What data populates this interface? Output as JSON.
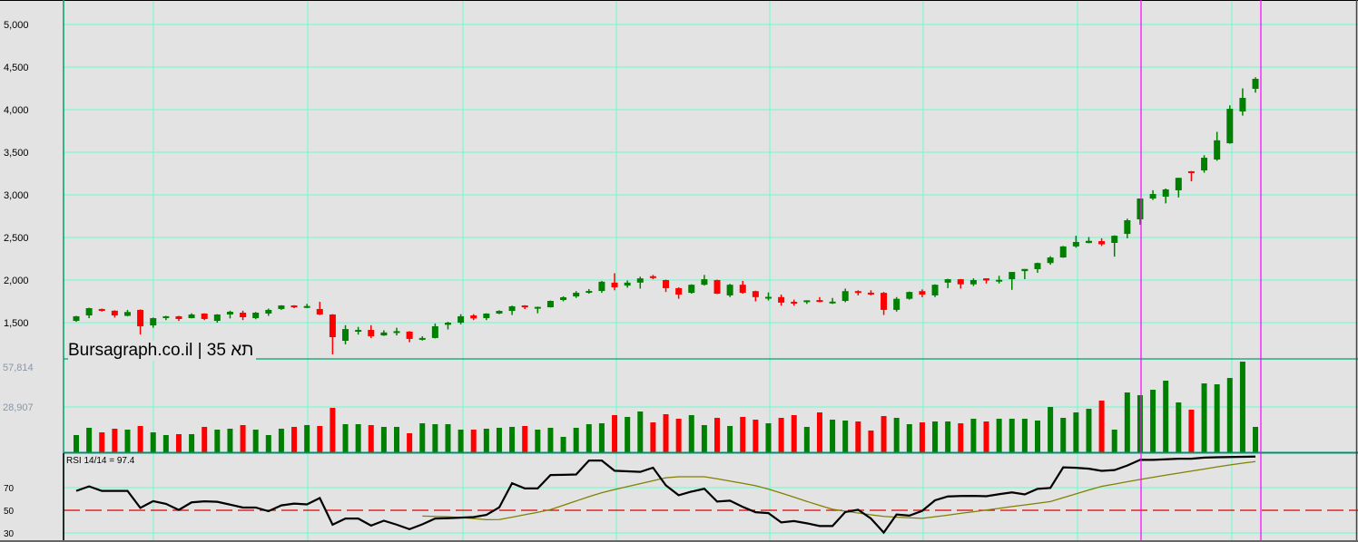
{
  "title": "Bursagraph.co.il | תא 35",
  "rsi_label": "RSI 14/14 = 97.4",
  "colors": {
    "up": "#008000",
    "down": "#ff0000",
    "grid": "#66ffcc",
    "axis": "#00a070",
    "marker": "#ff00ff",
    "rsi": "#000000",
    "signal": "#808000",
    "midline": "#e00000"
  },
  "chart_data": [
    {
      "type": "candlestick",
      "title": "Bursagraph.co.il | תא 35",
      "ylim": [
        1500,
        5000
      ],
      "y_ticks": [
        5000,
        4500,
        4000,
        3500,
        3000,
        2500,
        2000,
        1500
      ],
      "y_tick_labels": [
        "5,000",
        "4,500",
        "4,000",
        "3,500",
        "3,000",
        "2,500",
        "2,000",
        "1,500"
      ],
      "grid": true,
      "ohlc_order": [
        "open",
        "high",
        "low",
        "close"
      ],
      "ohlc": [
        [
          1521,
          1580,
          1510,
          1575
        ],
        [
          1585,
          1675,
          1553,
          1670
        ],
        [
          1660,
          1665,
          1630,
          1650
        ],
        [
          1640,
          1645,
          1560,
          1585
        ],
        [
          1580,
          1650,
          1575,
          1625
        ],
        [
          1650,
          1655,
          1362,
          1458
        ],
        [
          1468,
          1560,
          1440,
          1553
        ],
        [
          1565,
          1580,
          1530,
          1575
        ],
        [
          1575,
          1580,
          1520,
          1543
        ],
        [
          1553,
          1610,
          1550,
          1596
        ],
        [
          1607,
          1610,
          1530,
          1543
        ],
        [
          1521,
          1600,
          1500,
          1596
        ],
        [
          1596,
          1640,
          1550,
          1628
        ],
        [
          1617,
          1640,
          1530,
          1564
        ],
        [
          1553,
          1625,
          1540,
          1617
        ],
        [
          1607,
          1665,
          1580,
          1650
        ],
        [
          1660,
          1705,
          1650,
          1702
        ],
        [
          1702,
          1705,
          1670,
          1681
        ],
        [
          1692,
          1720,
          1670,
          1695
        ],
        [
          1660,
          1745,
          1590,
          1596
        ],
        [
          1596,
          1600,
          1128,
          1330
        ],
        [
          1287,
          1470,
          1245,
          1425
        ],
        [
          1405,
          1450,
          1360,
          1415
        ],
        [
          1415,
          1470,
          1320,
          1340
        ],
        [
          1350,
          1410,
          1345,
          1385
        ],
        [
          1395,
          1440,
          1350,
          1400
        ],
        [
          1395,
          1400,
          1270,
          1309
        ],
        [
          1310,
          1340,
          1290,
          1320
        ],
        [
          1320,
          1490,
          1315,
          1458
        ],
        [
          1475,
          1510,
          1420,
          1500
        ],
        [
          1500,
          1600,
          1480,
          1575
        ],
        [
          1585,
          1600,
          1530,
          1550
        ],
        [
          1553,
          1610,
          1530,
          1607
        ],
        [
          1607,
          1645,
          1600,
          1638
        ],
        [
          1638,
          1700,
          1590,
          1692
        ],
        [
          1702,
          1705,
          1660,
          1681
        ],
        [
          1680,
          1688,
          1610,
          1685
        ],
        [
          1681,
          1760,
          1678,
          1755
        ],
        [
          1766,
          1810,
          1750,
          1798
        ],
        [
          1808,
          1870,
          1790,
          1851
        ],
        [
          1868,
          1895,
          1840,
          1872
        ],
        [
          1872,
          1990,
          1850,
          1980
        ],
        [
          1970,
          2080,
          1880,
          1915
        ],
        [
          1935,
          1995,
          1910,
          1970
        ],
        [
          1970,
          2040,
          1900,
          2020
        ],
        [
          2045,
          2060,
          2010,
          2040
        ],
        [
          2000,
          2005,
          1860,
          1905
        ],
        [
          1905,
          1915,
          1780,
          1830
        ],
        [
          1850,
          1950,
          1840,
          1945
        ],
        [
          1945,
          2060,
          1935,
          2010
        ],
        [
          2000,
          2005,
          1835,
          1840
        ],
        [
          1820,
          1955,
          1800,
          1945
        ],
        [
          1945,
          1990,
          1840,
          1850
        ],
        [
          1870,
          1875,
          1750,
          1800
        ],
        [
          1800,
          1855,
          1760,
          1803
        ],
        [
          1800,
          1830,
          1700,
          1735
        ],
        [
          1745,
          1770,
          1700,
          1740
        ],
        [
          1758,
          1762,
          1720,
          1762
        ],
        [
          1765,
          1800,
          1740,
          1745
        ],
        [
          1743,
          1790,
          1720,
          1747
        ],
        [
          1755,
          1900,
          1740,
          1870
        ],
        [
          1870,
          1880,
          1820,
          1850
        ],
        [
          1852,
          1880,
          1820,
          1848
        ],
        [
          1850,
          1860,
          1590,
          1650
        ],
        [
          1650,
          1800,
          1630,
          1780
        ],
        [
          1780,
          1865,
          1770,
          1860
        ],
        [
          1870,
          1890,
          1800,
          1830
        ],
        [
          1820,
          1950,
          1800,
          1945
        ],
        [
          1970,
          2015,
          1905,
          2010
        ],
        [
          2010,
          2012,
          1900,
          1950
        ],
        [
          1950,
          2020,
          1930,
          2000
        ],
        [
          2020,
          2022,
          1960,
          1995
        ],
        [
          1998,
          2050,
          1960,
          2003
        ],
        [
          2010,
          2095,
          1885,
          2095
        ],
        [
          2105,
          2130,
          2010,
          2130
        ],
        [
          2128,
          2205,
          2085,
          2200
        ],
        [
          2200,
          2280,
          2180,
          2265
        ],
        [
          2265,
          2400,
          2262,
          2395
        ],
        [
          2395,
          2520,
          2380,
          2447
        ],
        [
          2435,
          2505,
          2432,
          2460
        ],
        [
          2457,
          2490,
          2400,
          2420
        ],
        [
          2436,
          2525,
          2275,
          2520
        ],
        [
          2542,
          2720,
          2490,
          2702
        ],
        [
          2713,
          2957,
          2650,
          2957
        ],
        [
          2957,
          3055,
          2940,
          3010
        ],
        [
          2979,
          3075,
          2900,
          3064
        ],
        [
          3053,
          3200,
          2970,
          3200
        ],
        [
          3277,
          3280,
          3160,
          3270
        ],
        [
          3287,
          3465,
          3260,
          3436
        ],
        [
          3415,
          3740,
          3400,
          3640
        ],
        [
          3606,
          4050,
          3600,
          4010
        ],
        [
          3979,
          4250,
          3930,
          4138
        ],
        [
          4245,
          4380,
          4200,
          4362
        ]
      ],
      "marker_indices": [
        83,
        93
      ]
    },
    {
      "type": "bar",
      "name": "volume",
      "ylim": [
        0,
        57814
      ],
      "y_ticks": [
        57814,
        28907
      ],
      "y_tick_labels": [
        "57,814",
        "28,907"
      ],
      "values": [
        10982,
        15606,
        12716,
        15028,
        14450,
        16762,
        12716,
        10982,
        11560,
        11560,
        16184,
        14450,
        15028,
        17340,
        14450,
        10982,
        15028,
        16184,
        17340,
        16762,
        28322,
        17918,
        17918,
        17340,
        16184,
        16184,
        12138,
        18496,
        17918,
        17918,
        14450,
        14450,
        15028,
        15606,
        16184,
        16762,
        14450,
        15606,
        9826,
        15606,
        17918,
        18496,
        23698,
        22542,
        26010,
        19074,
        24276,
        21386,
        23698,
        17340,
        21964,
        16762,
        22542,
        20808,
        18496,
        21964,
        23698,
        16184,
        25432,
        20808,
        20230,
        19652,
        13872,
        23120,
        21964,
        17918,
        19074,
        19652,
        19652,
        18496,
        21386,
        19652,
        21386,
        21386,
        21386,
        20230,
        28900,
        21964,
        25432,
        27744,
        32946,
        14450,
        38148,
        36414,
        39882,
        45662,
        31790,
        27166,
        43928,
        43350,
        47396,
        57800,
        16184
      ]
    },
    {
      "type": "line",
      "name": "RSI 14/14",
      "ylim": [
        25,
        100
      ],
      "y_ticks": [
        70,
        50,
        30
      ],
      "y_tick_labels": [
        "70",
        "50",
        "30"
      ],
      "series": [
        {
          "name": "RSI",
          "values": [
            67.1,
            71.1,
            67.1,
            67.1,
            67.1,
            52.1,
            58.1,
            55.7,
            50.3,
            57,
            57.9,
            57.5,
            55,
            52.4,
            52.4,
            49.2,
            54.3,
            55.9,
            55.2,
            60.8,
            37.3,
            42.7,
            42.7,
            36.5,
            40.8,
            37.3,
            33.3,
            37.6,
            42.7,
            43,
            43.5,
            44,
            45.9,
            52.5,
            73.9,
            69.3,
            69.3,
            81.1,
            81.3,
            81.6,
            93.9,
            93.9,
            84.9,
            84.4,
            83.9,
            87.6,
            72,
            63.3,
            66.5,
            69,
            57.7,
            58.5,
            53,
            48.3,
            47.5,
            39.3,
            40.5,
            38.5,
            36.1,
            36.1,
            48.5,
            50.5,
            42.7,
            30.3,
            46.3,
            45.3,
            49.5,
            58.8,
            62.2,
            62.6,
            62.7,
            62.4,
            64.2,
            65.8,
            64,
            68.9,
            69.7,
            87.9,
            87.5,
            86.7,
            84.8,
            85.5,
            89.5,
            94.5,
            94.5,
            95,
            95.5,
            95.5,
            96.5,
            96.8,
            97,
            97.2,
            97.4
          ]
        },
        {
          "name": "Signal",
          "start_index": 27,
          "values": [
            44.9,
            44.6,
            44.3,
            43.5,
            42.7,
            41.7,
            41.8,
            43.9,
            46.1,
            48.2,
            50.6,
            54.4,
            58.2,
            62,
            65.5,
            68.3,
            70.9,
            73.5,
            76.1,
            78.7,
            79.6,
            79.6,
            79.6,
            77.8,
            75.8,
            73.8,
            71.7,
            68.7,
            65.2,
            61.6,
            57.8,
            54.3,
            50.9,
            49.2,
            47.6,
            46,
            44.6,
            43.9,
            43.4,
            42.9,
            44.3,
            45.7,
            47.3,
            48.7,
            50.2,
            51.7,
            53.3,
            54.7,
            56.2,
            57.7,
            61.1,
            64.5,
            67.9,
            71.1,
            73.1,
            75.2,
            77.2,
            79.1,
            81,
            82.8,
            84.6,
            86.4,
            88.3,
            90,
            91.6,
            93
          ]
        }
      ],
      "reference_line": 50
    }
  ]
}
